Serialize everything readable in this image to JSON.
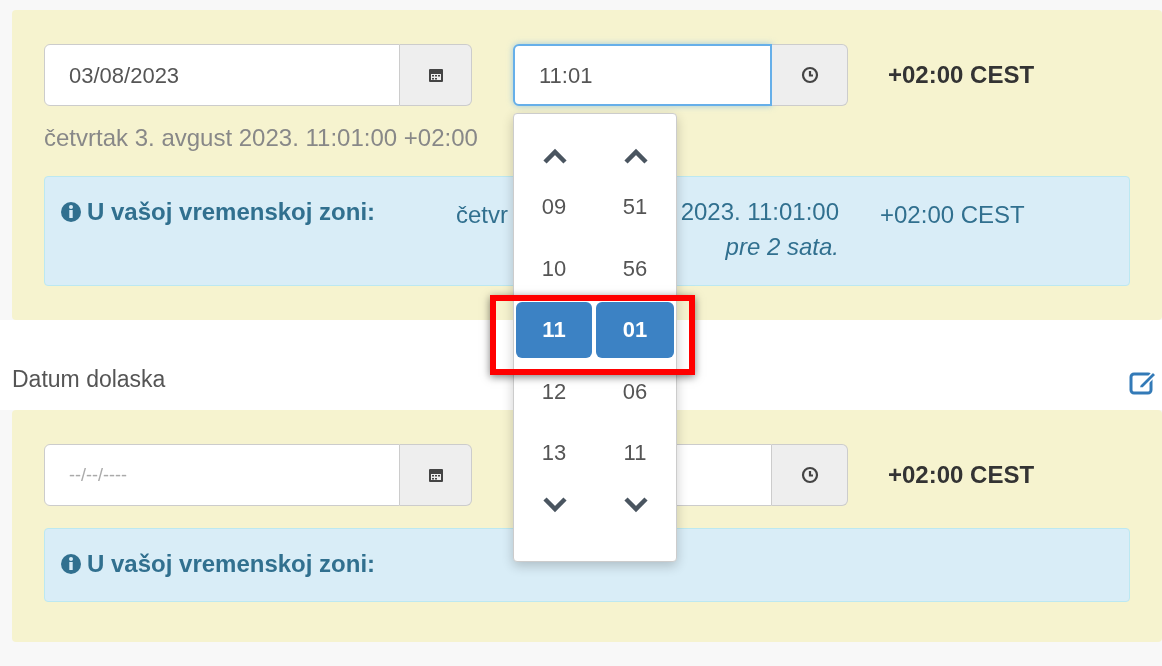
{
  "sections": [
    {
      "date_input": {
        "value": "03/08/2023"
      },
      "time_input": {
        "value": "11:01",
        "focused": true
      },
      "timezone": "+02:00 CEST",
      "help_text": "četvrtak 3. avgust 2023. 11:01:00 +02:00",
      "info": {
        "label": "U vašoj vremenskoj zoni:",
        "local_start": "četvr",
        "local_end": "2023. 11:01:00",
        "relative": "pre 2 sata.",
        "timezone": "+02:00 CEST"
      }
    },
    {
      "label": "Datum dolaska",
      "date_input": {
        "placeholder": "--/--/----"
      },
      "time_input": {
        "focused": false
      },
      "timezone": "+02:00 CEST",
      "info": {
        "label": "U vašoj vremenskoj zoni:"
      }
    }
  ],
  "time_picker": {
    "rows": [
      {
        "hour": "09",
        "minute": "51",
        "selected": false
      },
      {
        "hour": "10",
        "minute": "56",
        "selected": false
      },
      {
        "hour": "11",
        "minute": "01",
        "selected": true
      },
      {
        "hour": "12",
        "minute": "06",
        "selected": false
      },
      {
        "hour": "13",
        "minute": "11",
        "selected": false
      }
    ]
  }
}
